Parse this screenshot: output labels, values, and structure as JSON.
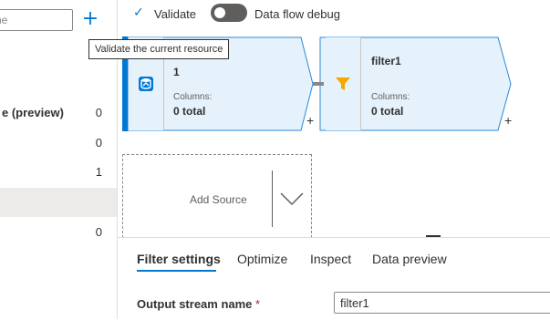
{
  "left_panel": {
    "search": {
      "value": "",
      "placeholder": "ne"
    },
    "rows": [
      {
        "label": "e (preview)",
        "count": "0"
      },
      {
        "label": "",
        "count": "0"
      },
      {
        "label": "",
        "count": "1"
      },
      {
        "label": "",
        "count": ""
      },
      {
        "label": "",
        "count": "0"
      }
    ]
  },
  "toolbar": {
    "validate_label": "Validate",
    "debug_label": "Data flow debug",
    "debug_on": false
  },
  "tooltip": {
    "text": "Validate the current resource"
  },
  "nodes": {
    "source": {
      "title": "1",
      "columns_label": "Columns:",
      "columns_value": "0 total",
      "icon": "data-source-icon"
    },
    "filter": {
      "title": "filter1",
      "columns_label": "Columns:",
      "columns_value": "0 total",
      "icon": "filter-funnel-icon"
    },
    "plus_symbol": "+"
  },
  "add_source": {
    "label": "Add Source",
    "icon": "chevron-down-icon"
  },
  "bottom_panel": {
    "tabs": [
      {
        "label": "Filter settings",
        "active": true
      },
      {
        "label": "Optimize",
        "active": false
      },
      {
        "label": "Inspect",
        "active": false
      },
      {
        "label": "Data preview",
        "active": false
      }
    ],
    "output_stream": {
      "label": "Output stream name",
      "required": "*",
      "value": "filter1"
    }
  },
  "colors": {
    "accent": "#0078d4",
    "node_fill": "#e5f1fb",
    "node_border": "#2b88d8",
    "filter_icon": "#f7a600"
  }
}
